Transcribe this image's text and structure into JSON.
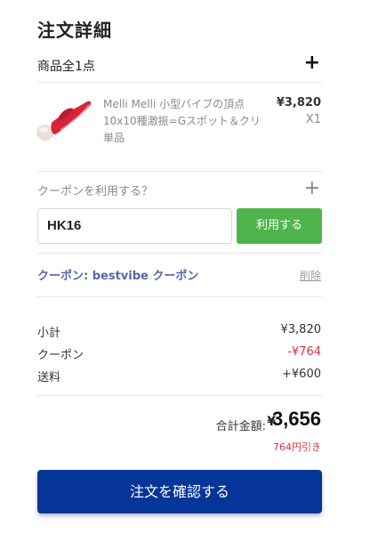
{
  "order": {
    "title": "注文詳細",
    "items_count": "商品全1点",
    "expand_glyph": "+"
  },
  "product": {
    "name": "Melli Melli 小型バイブの頂点 10x10種激振=Gスポット＆クリ単品",
    "price": "¥3,820",
    "qty": "X1",
    "image_icon": "vibrator-product-image"
  },
  "coupon": {
    "prompt": "クーポンを利用する？",
    "expand_glyph": "+",
    "input_value": "HK16",
    "apply_label": "利用する",
    "applied_text": "クーポン: bestvibe クーポン",
    "remove_label": "削除"
  },
  "summary": {
    "subtotal_label": "小計",
    "subtotal_value": "¥3,820",
    "coupon_label": "クーポン",
    "coupon_value": "-¥764",
    "shipping_label": "送料",
    "shipping_value": "+¥600",
    "total_label": "合計金額:",
    "total_currency": "¥",
    "total_value": "3,656",
    "discount_note": "764円引き"
  },
  "actions": {
    "confirm_label": "注文を確認する"
  },
  "colors": {
    "apply_button": "#4fb44b",
    "confirm_button": "#053598",
    "discount_red": "#d9333f",
    "coupon_link": "#5566aa"
  }
}
